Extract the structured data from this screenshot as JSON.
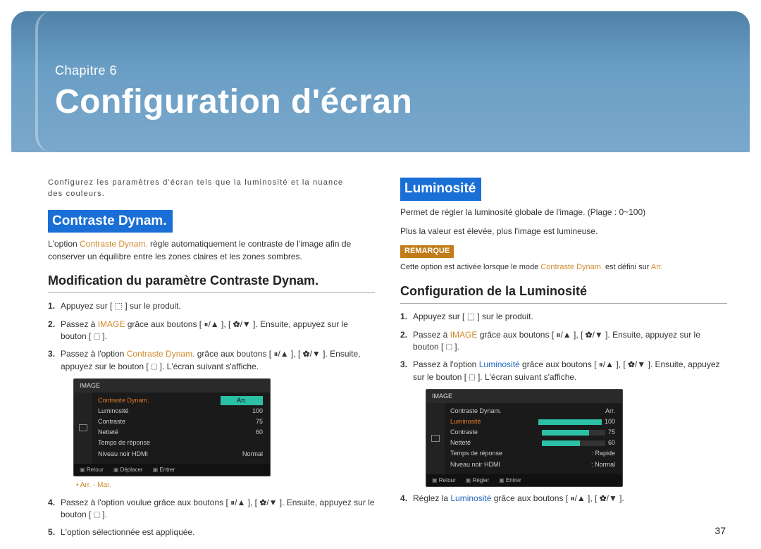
{
  "hero": {
    "chapter": "Chapitre 6",
    "title": "Configuration d'écran"
  },
  "page_number": "37",
  "intro": "Configurez les paramètres d'écran tels que la luminosité et la nuance des couleurs.",
  "left": {
    "heading": "Contraste Dynam.",
    "desc_pre": "L'option ",
    "desc_em": "Contraste Dynam.",
    "desc_post": " règle automatiquement le contraste de l'image afin de conserver un équilibre entre les zones claires et les zones sombres.",
    "sub_heading": "Modification du paramètre Contraste Dynam.",
    "steps": {
      "s1": "Appuyez sur [ ⬚ ] sur le produit.",
      "s2_pre": "Passez à ",
      "s2_em": "IMAGE",
      "s2_post": " grâce aux boutons [ ⏸/▲ ], [ ✿/▼ ]. Ensuite, appuyez sur le bouton [ ⬚ ].",
      "s3_pre": "Passez à l'option ",
      "s3_em": "Contraste Dynam.",
      "s3_post": " grâce aux boutons [ ⏸/▲ ], [ ✿/▼ ]. Ensuite, appuyez sur le bouton [ ⬚ ]. L'écran suivant s'affiche.",
      "s4": "Passez à l'option voulue grâce aux boutons [ ⏸/▲ ], [ ✿/▼ ]. Ensuite, appuyez sur le bouton [ ⬚ ].",
      "s5": "L'option sélectionnée est appliquée."
    },
    "options": "Arr. - Mar.",
    "menu": {
      "title": "IMAGE",
      "rows": [
        {
          "label": "Contraste Dynam.",
          "value": "Arr.",
          "hl": true
        },
        {
          "label": "Luminosité",
          "value": "100"
        },
        {
          "label": "Contraste",
          "value": "75"
        },
        {
          "label": "Netteté",
          "value": "60"
        },
        {
          "label": "Temps de réponse",
          "value": ""
        },
        {
          "label": "Niveau noir HDMI",
          "value": "Normal"
        }
      ],
      "foot": [
        "Retour",
        "Déplacer",
        "Entrer"
      ]
    }
  },
  "right": {
    "heading": "Luminosité",
    "desc": "Permet de régler la luminosité globale de l'image. (Plage : 0~100)",
    "desc2": "Plus la valeur est élevée, plus l'image est lumineuse.",
    "remark_label": "REMARQUE",
    "remark_pre": "Cette option est activée lorsque le mode ",
    "remark_em": "Contraste Dynam.",
    "remark_post": " est défini sur ",
    "remark_em2": "Arr.",
    "sub_heading": "Configuration de la Luminosité",
    "steps": {
      "s1": "Appuyez sur [ ⬚ ] sur le produit.",
      "s2_pre": "Passez à ",
      "s2_em": "IMAGE",
      "s2_post": " grâce aux boutons [ ⏸/▲ ], [ ✿/▼ ]. Ensuite, appuyez sur le bouton [ ⬚ ].",
      "s3_pre": "Passez à l'option ",
      "s3_em": "Luminosité",
      "s3_post": " grâce aux boutons [ ⏸/▲ ], [ ✿/▼ ]. Ensuite, appuyez sur le bouton [ ⬚ ]. L'écran suivant s'affiche.",
      "s4_pre": "Réglez la ",
      "s4_em": "Luminosité",
      "s4_post": " grâce aux boutons [ ⏸/▲ ], [ ✿/▼ ]."
    },
    "menu": {
      "title": "IMAGE",
      "rows": [
        {
          "label": "Contraste Dynam.",
          "value": "Arr."
        },
        {
          "label": "Luminosité",
          "value": "100",
          "hl": true,
          "bar": 100
        },
        {
          "label": "Contraste",
          "value": "75",
          "bar": 75
        },
        {
          "label": "Netteté",
          "value": "60",
          "bar": 60
        },
        {
          "label": "Temps de réponse",
          "value": ": Rapide"
        },
        {
          "label": "Niveau noir HDMI",
          "value": ": Normal"
        }
      ],
      "foot": [
        "Retour",
        "Régler",
        "Entrer"
      ]
    }
  }
}
